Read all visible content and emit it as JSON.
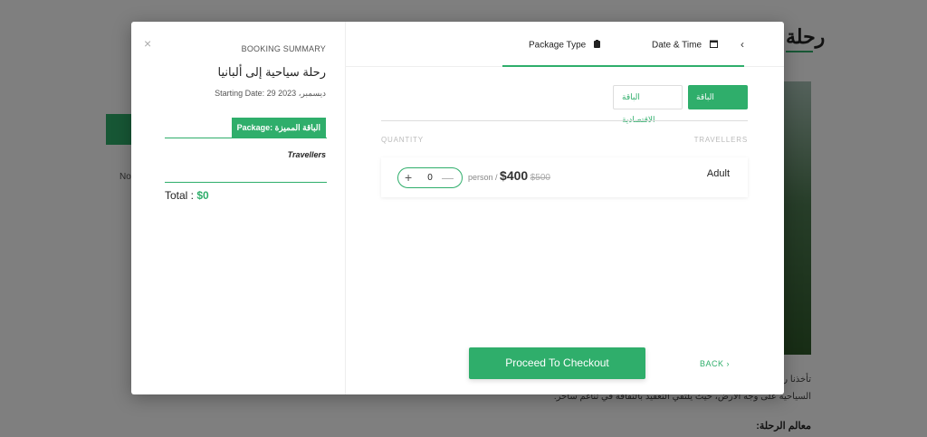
{
  "background": {
    "title": "رحلة",
    "card_text": "No",
    "paragraph_line1": "تأخذنا ر",
    "paragraph_line2": "السياحية على وجه الأرض، حيث يلتقي التعقيد بالثقافة في تناغم ساحر.",
    "heading": "معالم الرحلة:"
  },
  "summary": {
    "close_label": "×",
    "label": "BOOKING SUMMARY",
    "trip_title": "رحلة سياحية إلى ألبانيا",
    "starting_date": "Starting Date: 29 ديسمبر، 2023",
    "package_badge": "Package: الباقة المميزة",
    "travellers_label": "Travellers",
    "total_label": "Total : ",
    "total_amount": "$0"
  },
  "tabs": {
    "package_type": "Package Type",
    "date_time": "Date & Time",
    "arrow": "‹"
  },
  "packages": {
    "premium": "الباقة المميزة",
    "economy": "الباقة الاقتصادية"
  },
  "columns": {
    "quantity": "QUANTITY",
    "travellers": "TRAVELLERS"
  },
  "row": {
    "plus": "+",
    "minus": "—",
    "quantity": "0",
    "per": "person / ",
    "price_now": "$400",
    "price_old": "$500",
    "type": "Adult"
  },
  "actions": {
    "proceed": "Proceed To Checkout",
    "back": "BACK ›"
  },
  "colors": {
    "accent": "#2fae6b"
  }
}
